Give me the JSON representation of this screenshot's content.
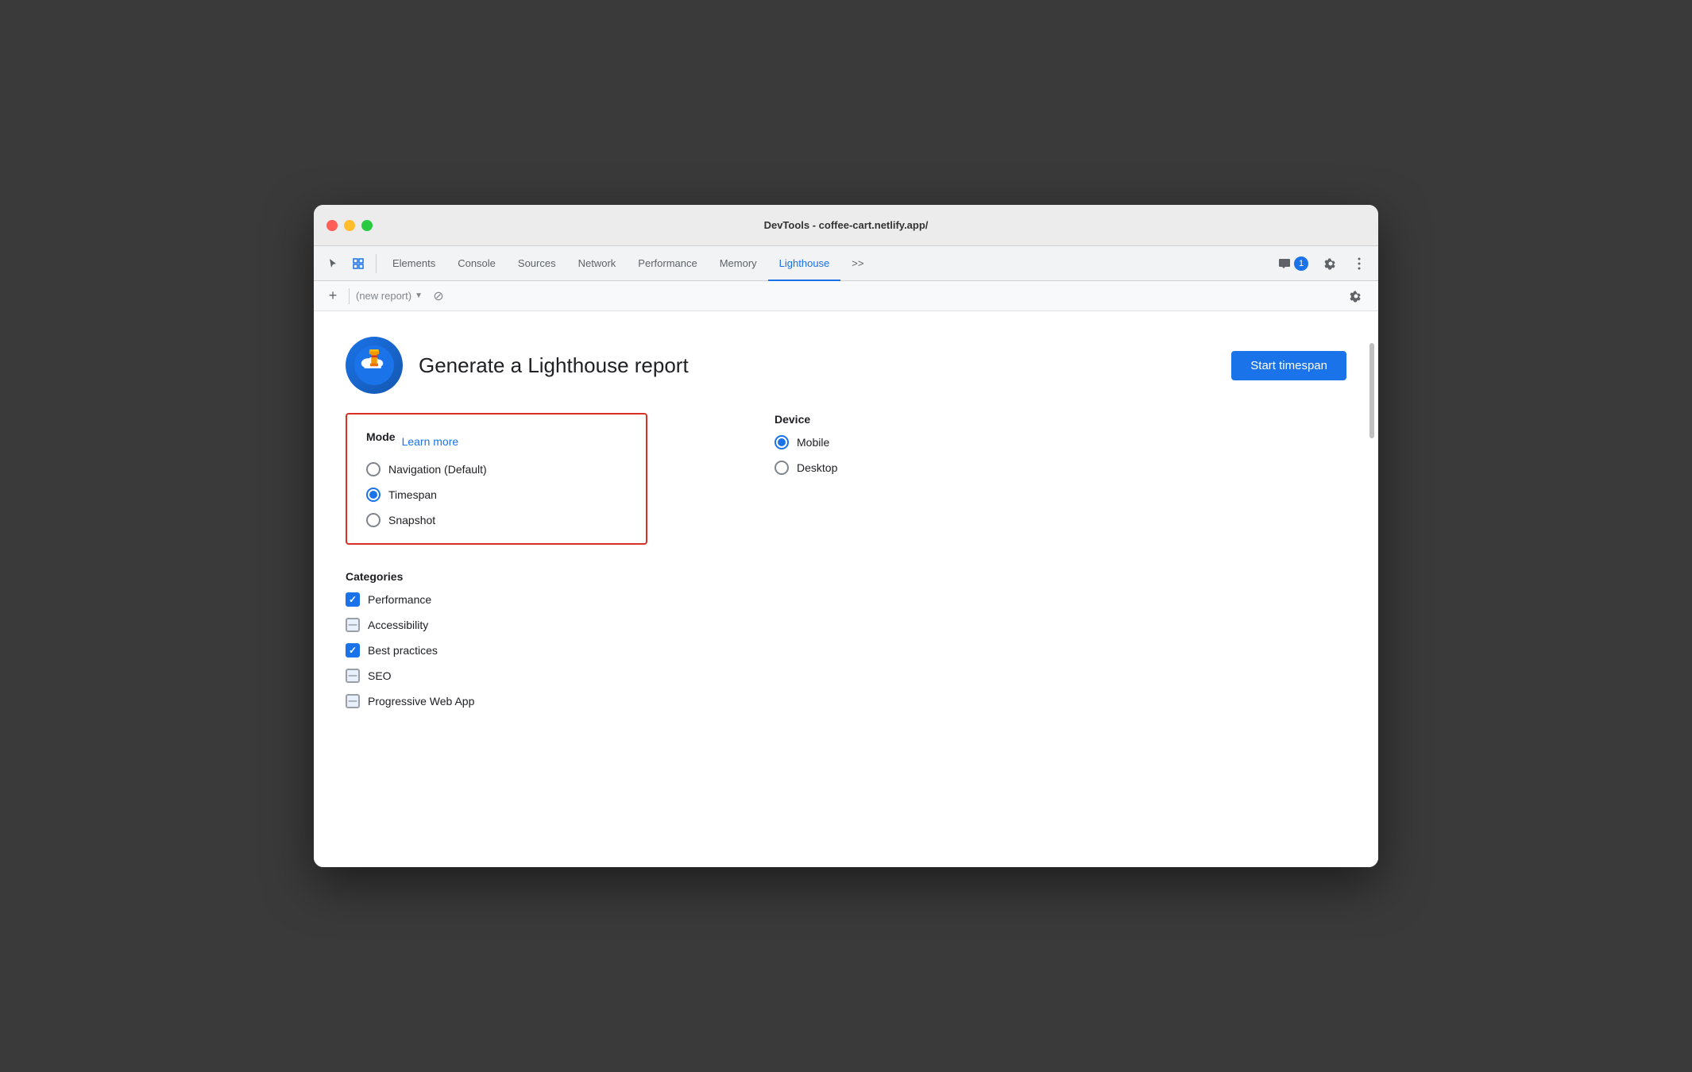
{
  "window": {
    "title": "DevTools - coffee-cart.netlify.app/"
  },
  "tabs": {
    "items": [
      {
        "id": "elements",
        "label": "Elements",
        "active": false
      },
      {
        "id": "console",
        "label": "Console",
        "active": false
      },
      {
        "id": "sources",
        "label": "Sources",
        "active": false
      },
      {
        "id": "network",
        "label": "Network",
        "active": false
      },
      {
        "id": "performance",
        "label": "Performance",
        "active": false
      },
      {
        "id": "memory",
        "label": "Memory",
        "active": false
      },
      {
        "id": "lighthouse",
        "label": "Lighthouse",
        "active": true
      }
    ],
    "more_label": ">>",
    "badge_count": "1"
  },
  "lighthouse_toolbar": {
    "add_label": "+",
    "report_placeholder": "(new report)",
    "cancel_title": "Cancel"
  },
  "header": {
    "title": "Generate a Lighthouse report",
    "start_button": "Start timespan"
  },
  "mode": {
    "title": "Mode",
    "learn_more": "Learn more",
    "options": [
      {
        "id": "navigation",
        "label": "Navigation (Default)",
        "checked": false
      },
      {
        "id": "timespan",
        "label": "Timespan",
        "checked": true
      },
      {
        "id": "snapshot",
        "label": "Snapshot",
        "checked": false
      }
    ]
  },
  "device": {
    "title": "Device",
    "options": [
      {
        "id": "mobile",
        "label": "Mobile",
        "checked": true
      },
      {
        "id": "desktop",
        "label": "Desktop",
        "checked": false
      }
    ]
  },
  "categories": {
    "title": "Categories",
    "items": [
      {
        "id": "performance",
        "label": "Performance",
        "state": "checked"
      },
      {
        "id": "accessibility",
        "label": "Accessibility",
        "state": "indeterminate"
      },
      {
        "id": "best-practices",
        "label": "Best practices",
        "state": "checked"
      },
      {
        "id": "seo",
        "label": "SEO",
        "state": "indeterminate"
      },
      {
        "id": "pwa",
        "label": "Progressive Web App",
        "state": "indeterminate"
      }
    ]
  },
  "colors": {
    "accent_blue": "#1a73e8",
    "border_red": "#d93025",
    "text_primary": "#202124",
    "text_secondary": "#5f6368"
  }
}
